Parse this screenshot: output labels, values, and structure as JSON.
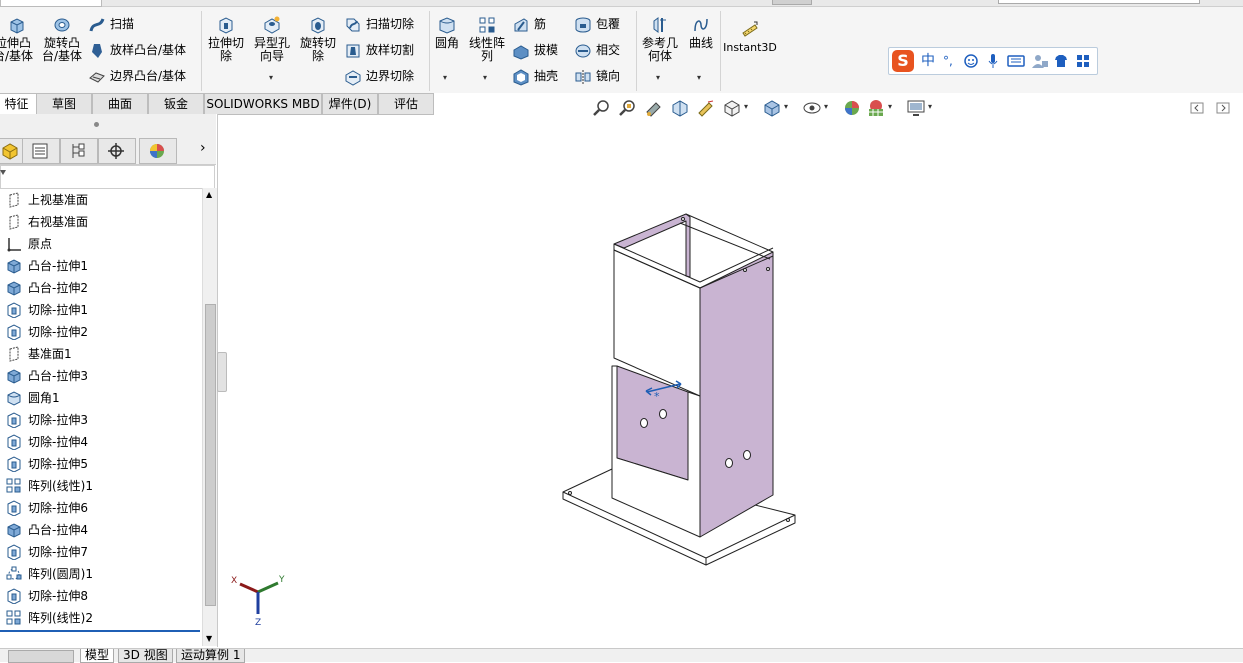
{
  "ribbon": {
    "features": [
      {
        "label": "拉伸凸\n台/基体"
      },
      {
        "label": "旋转凸\n台/基体"
      }
    ],
    "small_col1": [
      "扫描",
      "放样凸台/基体",
      "边界凸台/基体"
    ],
    "cut_buttons": [
      {
        "label": "拉伸切\n除"
      },
      {
        "label": "异型孔\n向导"
      },
      {
        "label": "旋转切\n除"
      }
    ],
    "small_col2": [
      "扫描切除",
      "放样切割",
      "边界切除"
    ],
    "fillet": {
      "label": "圆角"
    },
    "linear_pattern": {
      "label": "线性阵\n列"
    },
    "small_col3": [
      "筋",
      "拔模",
      "抽壳"
    ],
    "small_col4": [
      "包覆",
      "相交",
      "镜向"
    ],
    "ref_geometry": {
      "label": "参考几\n何体"
    },
    "curves": {
      "label": "曲线"
    },
    "instant3d": {
      "label": "Instant3D"
    }
  },
  "ime": {
    "logo": "S",
    "mode": "中",
    "punct": "°,"
  },
  "tabs": [
    "特征",
    "草图",
    "曲面",
    "钣金",
    "SOLIDWORKS MBD",
    "焊件(D)",
    "评估"
  ],
  "feature_tree": [
    {
      "label": "上视基准面",
      "icon": "plane-icon"
    },
    {
      "label": "右视基准面",
      "icon": "plane-icon"
    },
    {
      "label": "原点",
      "icon": "origin-icon"
    },
    {
      "label": "凸台-拉伸1",
      "icon": "boss-extrude-icon"
    },
    {
      "label": "凸台-拉伸2",
      "icon": "boss-extrude-icon"
    },
    {
      "label": "切除-拉伸1",
      "icon": "cut-extrude-icon"
    },
    {
      "label": "切除-拉伸2",
      "icon": "cut-extrude-icon"
    },
    {
      "label": "基准面1",
      "icon": "plane-icon"
    },
    {
      "label": "凸台-拉伸3",
      "icon": "boss-extrude-icon"
    },
    {
      "label": "圆角1",
      "icon": "fillet-icon"
    },
    {
      "label": "切除-拉伸3",
      "icon": "cut-extrude-icon"
    },
    {
      "label": "切除-拉伸4",
      "icon": "cut-extrude-icon"
    },
    {
      "label": "切除-拉伸5",
      "icon": "cut-extrude-icon"
    },
    {
      "label": "阵列(线性)1",
      "icon": "linear-pattern-icon"
    },
    {
      "label": "切除-拉伸6",
      "icon": "cut-extrude-icon"
    },
    {
      "label": "凸台-拉伸4",
      "icon": "boss-extrude-icon"
    },
    {
      "label": "切除-拉伸7",
      "icon": "cut-extrude-icon"
    },
    {
      "label": "阵列(圆周)1",
      "icon": "circular-pattern-icon"
    },
    {
      "label": "切除-拉伸8",
      "icon": "cut-extrude-icon"
    },
    {
      "label": "阵列(线性)2",
      "icon": "linear-pattern-icon"
    }
  ],
  "bottom_tabs": [
    "模型",
    "3D 视图",
    "运动算例 1"
  ],
  "triad": {
    "x": "X",
    "y": "Y",
    "z": "Z"
  },
  "colors": {
    "part_face": "#c9b4d2",
    "accent_blue": "#1f5fb5",
    "ime_logo": "#e8531f"
  }
}
